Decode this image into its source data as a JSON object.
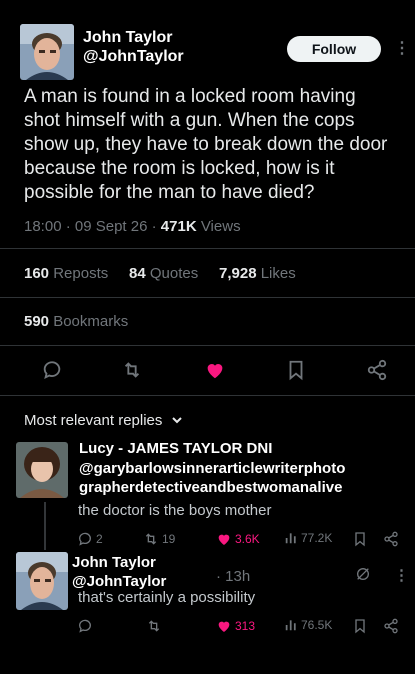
{
  "tweet": {
    "author_name": "John Taylor",
    "author_handle": "@JohnTaylor",
    "follow_label": "Follow",
    "text": "A man is found in a locked room having shot himself with a gun. When the cops show up, they have to break down the door because the room is locked, how is it possible for the man to have died?",
    "time": "18:00",
    "date": "09 Sept 26",
    "views_count": "471K",
    "views_label": "Views"
  },
  "stats": {
    "reposts_count": "160",
    "reposts_label": "Reposts",
    "quotes_count": "84",
    "quotes_label": "Quotes",
    "likes_count": "7,928",
    "likes_label": "Likes",
    "bookmarks_count": "590",
    "bookmarks_label": "Bookmarks"
  },
  "replies_header": "Most relevant replies",
  "replies": [
    {
      "name_line1": "Lucy - JAMES TAYLOR DNI",
      "name_line2": "@garybarlowsinnerarticlewriterphoto",
      "name_line3": "grapherdetectiveandbestwomanalive",
      "text": "the doctor is the boys mother",
      "reply_count": "2",
      "repost_count": "19",
      "like_count": "3.6K",
      "view_count": "77.2K"
    },
    {
      "name": "John Taylor",
      "handle": "@JohnTaylor",
      "time": "· 13h",
      "text": "that's certainly a possibility",
      "like_count": "313",
      "view_count": "76.5K"
    }
  ],
  "colors": {
    "like": "#f91880",
    "muted": "#71767b",
    "background": "#000000"
  }
}
